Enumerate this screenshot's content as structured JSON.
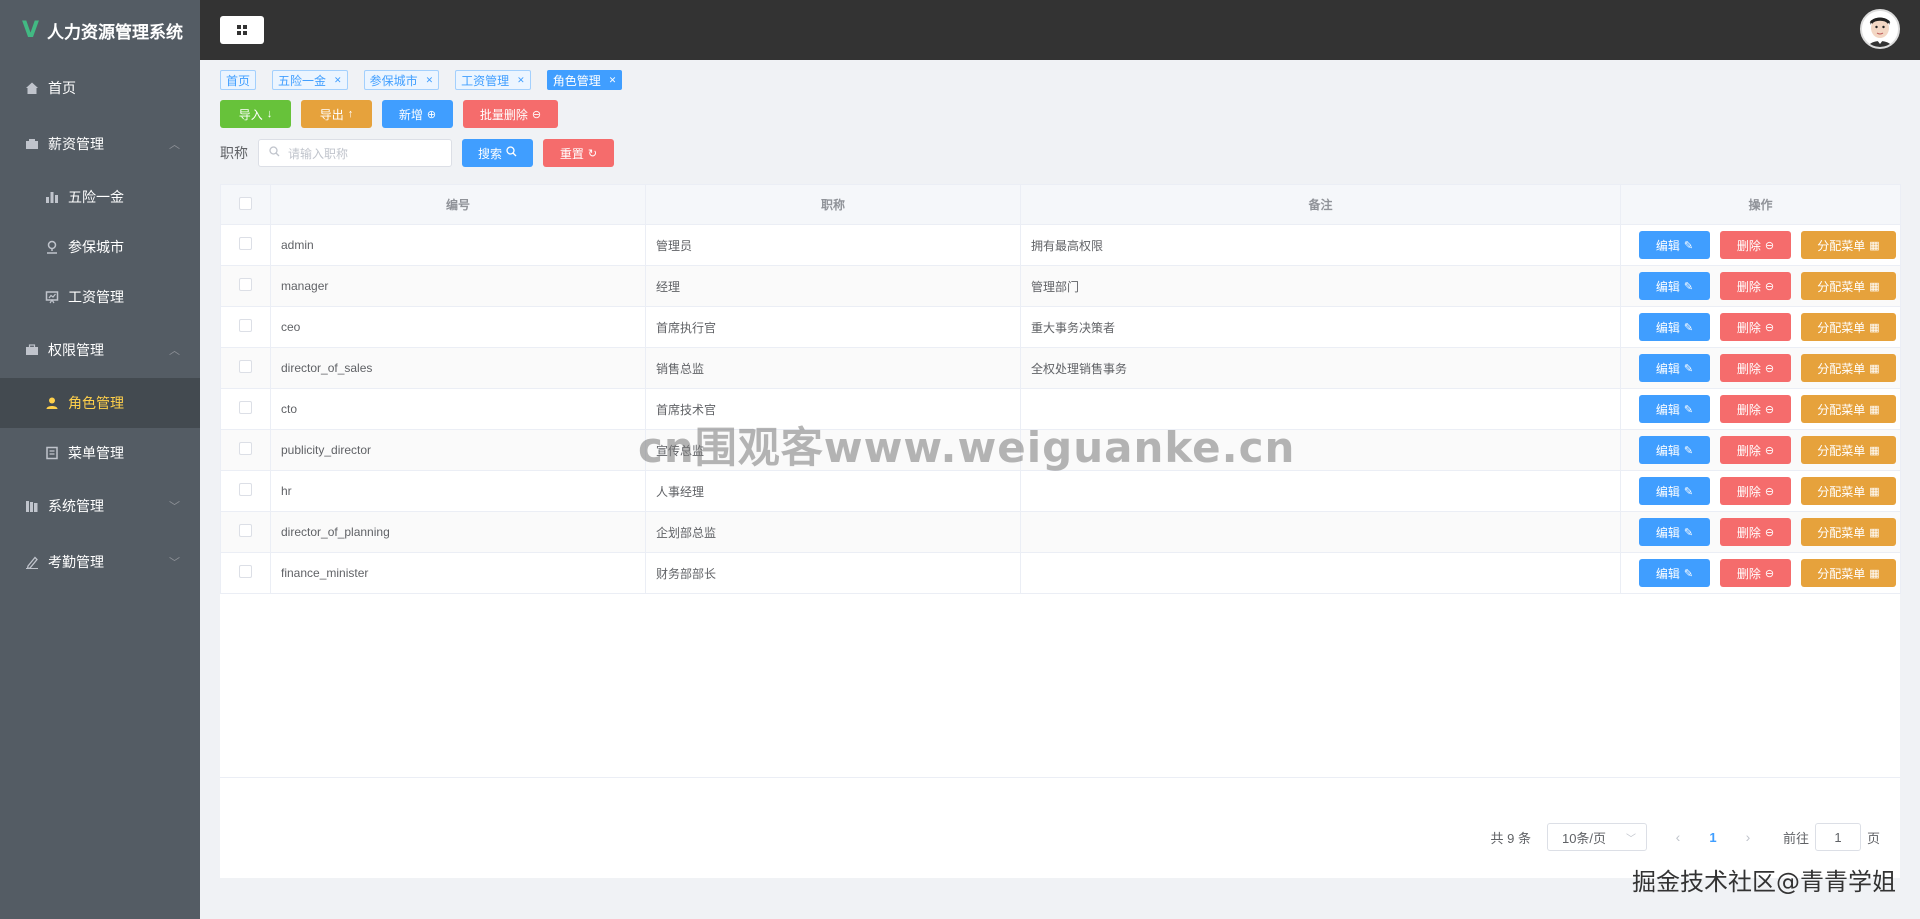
{
  "app": {
    "title": "人力资源管理系统",
    "logo_letter": "V"
  },
  "sidebar": {
    "items": [
      {
        "label": "首页",
        "icon": "home-icon",
        "level": 1
      },
      {
        "label": "薪资管理",
        "icon": "wallet-icon",
        "level": 1,
        "expanded": true
      },
      {
        "label": "五险一金",
        "icon": "bar-chart-icon",
        "level": 2
      },
      {
        "label": "参保城市",
        "icon": "location-icon",
        "level": 2
      },
      {
        "label": "工资管理",
        "icon": "presentation-icon",
        "level": 2
      },
      {
        "label": "权限管理",
        "icon": "briefcase-icon",
        "level": 1,
        "expanded": true
      },
      {
        "label": "角色管理",
        "icon": "user-icon",
        "level": 2,
        "active": true
      },
      {
        "label": "菜单管理",
        "icon": "document-icon",
        "level": 2
      },
      {
        "label": "系统管理",
        "icon": "library-icon",
        "level": 1
      },
      {
        "label": "考勤管理",
        "icon": "edit-icon",
        "level": 1
      }
    ]
  },
  "tags": [
    {
      "label": "首页",
      "closable": false
    },
    {
      "label": "五险一金",
      "closable": true
    },
    {
      "label": "参保城市",
      "closable": true
    },
    {
      "label": "工资管理",
      "closable": true
    },
    {
      "label": "角色管理",
      "closable": true,
      "active": true
    }
  ],
  "toolbar": {
    "import_label": "导入",
    "export_label": "导出",
    "add_label": "新增",
    "batch_delete_label": "批量删除"
  },
  "search": {
    "label": "职称",
    "placeholder": "请输入职称",
    "search_label": "搜索",
    "reset_label": "重置"
  },
  "table": {
    "columns": [
      "编号",
      "职称",
      "备注",
      "操作"
    ],
    "rows": [
      {
        "id": "admin",
        "title": "管理员",
        "remark": "拥有最高权限"
      },
      {
        "id": "manager",
        "title": "经理",
        "remark": "管理部门"
      },
      {
        "id": "ceo",
        "title": "首席执行官",
        "remark": "重大事务决策者"
      },
      {
        "id": "director_of_sales",
        "title": "销售总监",
        "remark": "全权处理销售事务"
      },
      {
        "id": "cto",
        "title": "首席技术官",
        "remark": ""
      },
      {
        "id": "publicity_director",
        "title": "宣传总监",
        "remark": ""
      },
      {
        "id": "hr",
        "title": "人事经理",
        "remark": ""
      },
      {
        "id": "director_of_planning",
        "title": "企划部总监",
        "remark": ""
      },
      {
        "id": "finance_minister",
        "title": "财务部部长",
        "remark": ""
      }
    ],
    "actions": {
      "edit": "编辑",
      "delete": "删除",
      "assign": "分配菜单"
    }
  },
  "pagination": {
    "total_text": "共 9 条",
    "page_size": "10条/页",
    "current_page": "1",
    "goto_prefix": "前往",
    "goto_value": "1",
    "goto_suffix": "页"
  },
  "watermarks": {
    "center": "cn围观客www.weiguanke.cn",
    "corner": "掘金技术社区@青青学姐"
  },
  "colors": {
    "sidebar_bg": "#545c64",
    "header_bg": "#333333",
    "active_text": "#ffd04b",
    "primary": "#409eff",
    "success": "#67c23a",
    "warning": "#e6a23c",
    "danger": "#f56c6c"
  }
}
